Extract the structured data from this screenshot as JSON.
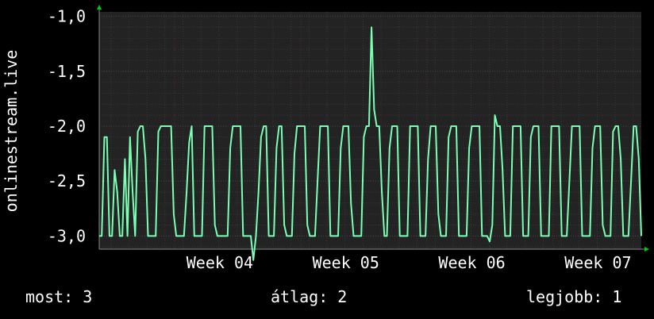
{
  "colors": {
    "background": "#000000",
    "plot_background": "#232323",
    "grid_minor": "#383838",
    "grid_major_x": "#5a2a2a",
    "series": "#7affb4",
    "arrow": "#00cc00",
    "text": "#ffffff"
  },
  "legend": {
    "now": "most: 3",
    "avg": "átlag: 2",
    "best": "legjobb: 1"
  },
  "chart_data": {
    "type": "line",
    "ylabel": "onlinestream.live",
    "y_ticks": [
      "-1,0",
      "-1,5",
      "-2,0",
      "-2,5",
      "-3,0"
    ],
    "y_tick_values": [
      -1.0,
      -1.5,
      -2.0,
      -2.5,
      -3.0
    ],
    "ylim": [
      -3.12,
      -0.96
    ],
    "x_ticks": [
      "Week 04",
      "Week 05",
      "Week 06",
      "Week 07"
    ],
    "x_tick_values": [
      4,
      5,
      6,
      7
    ],
    "xlim": [
      3.05,
      7.35
    ],
    "grid": true,
    "series": [
      {
        "values": [
          -3,
          -3,
          -2.1,
          -2.1,
          -3,
          -3,
          -2.4,
          -2.6,
          -3,
          -3,
          -2.3,
          -3,
          -2.1,
          -2.6,
          -3,
          -2.05,
          -2,
          -2,
          -2.3,
          -3,
          -3,
          -3,
          -3,
          -2.05,
          -2,
          -2,
          -2,
          -2,
          -2,
          -2.8,
          -3,
          -3,
          -3,
          -3,
          -2.6,
          -2.15,
          -2,
          -3,
          -3,
          -3,
          -3,
          -2,
          -2,
          -2,
          -2,
          -2.9,
          -3,
          -3,
          -3,
          -3,
          -3,
          -2.2,
          -2,
          -2,
          -2,
          -2,
          -3,
          -3,
          -3,
          -3,
          -3.22,
          -3,
          -2.6,
          -2.1,
          -2,
          -2,
          -3,
          -3,
          -3,
          -2.2,
          -2,
          -2,
          -2.9,
          -3,
          -3,
          -3,
          -2.25,
          -2,
          -2,
          -2,
          -2,
          -2.9,
          -3,
          -3,
          -3,
          -2.5,
          -2,
          -2,
          -2,
          -2,
          -3,
          -3,
          -3,
          -3,
          -2.2,
          -2,
          -2,
          -2,
          -2.7,
          -3,
          -3,
          -3,
          -3,
          -2.1,
          -2,
          -2,
          -1.1,
          -1.85,
          -2,
          -2,
          -2.6,
          -3,
          -3,
          -2.2,
          -2,
          -2,
          -2,
          -3,
          -3,
          -3,
          -3,
          -2,
          -2,
          -2,
          -2,
          -3,
          -3,
          -3,
          -2.3,
          -2,
          -2,
          -2,
          -2.8,
          -3,
          -3,
          -3,
          -2.1,
          -2,
          -2,
          -2,
          -3,
          -3,
          -3,
          -3,
          -2.2,
          -2,
          -2,
          -2,
          -2,
          -3,
          -3,
          -3,
          -3.05,
          -2.9,
          -1.9,
          -2,
          -2,
          -2.4,
          -3,
          -3,
          -3,
          -2,
          -2,
          -2,
          -2,
          -3,
          -3,
          -3,
          -2.1,
          -2,
          -2,
          -2,
          -3,
          -3,
          -3,
          -3,
          -2,
          -2,
          -2,
          -2,
          -3,
          -3,
          -3,
          -2.5,
          -2,
          -2,
          -2,
          -2,
          -3,
          -3,
          -3,
          -3,
          -2.2,
          -2,
          -2,
          -2,
          -2.9,
          -3,
          -3,
          -3,
          -2.05,
          -2,
          -2,
          -2.3,
          -3,
          -3,
          -3,
          -2.5,
          -2,
          -2,
          -2.3,
          -3
        ]
      }
    ]
  }
}
